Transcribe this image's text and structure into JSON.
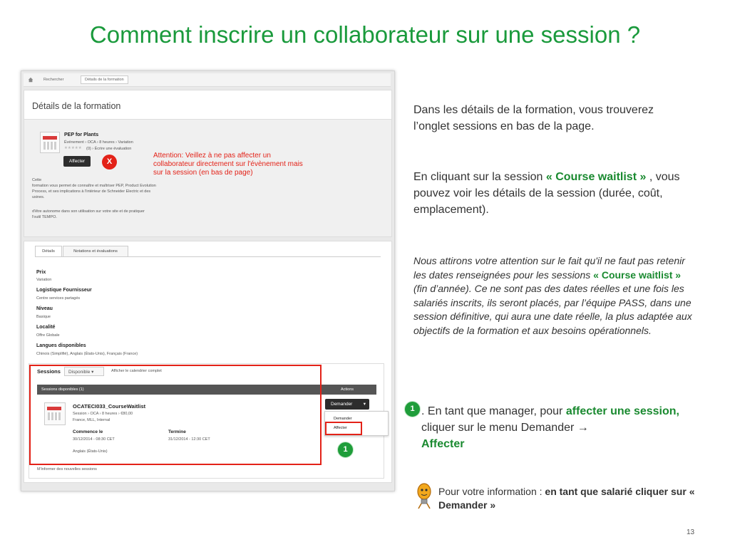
{
  "slide": {
    "title": "Comment inscrire un collaborateur sur une session ?",
    "page_number": "13"
  },
  "screenshot": {
    "breadcrumb": [
      "Rechercher",
      "Détails de la formation"
    ],
    "header_title": "Détails de la formation",
    "course": {
      "name": "PEP for Plants",
      "meta": "Événement  ›  OCA  ›  8 heures  ›  Variation",
      "rating": "(0)  ›  Écrire une évaluation",
      "affect_button": "Affecter",
      "desc1": "Cette",
      "desc2": "formation vous permet de connaître et maîtriser PEP, Product Evolution",
      "desc3": "Process, et ses implications à l'intérieur de Schneider Electric et des",
      "desc4": "usines.",
      "desc5": "d'être autonome dans son utilisation sur votre site et de pratiquer",
      "desc6": "l'outil TEMPO."
    },
    "tabs": [
      "Détails",
      "Notations et évaluations"
    ],
    "details": [
      {
        "label": "Prix",
        "value": "Variation"
      },
      {
        "label": "Logistique Fournisseur",
        "value": "Centre services partagés"
      },
      {
        "label": "Niveau",
        "value": "Basique"
      },
      {
        "label": "Localité",
        "value": "Offre Globale"
      },
      {
        "label": "Langues disponibles",
        "value": "Chinois (Simplifié), Anglais (États-Unis), Français (France)"
      }
    ],
    "sessions": {
      "tab_label": "Sessions",
      "filter": "Disponible",
      "calendar_link": "Afficher le calendrier complet",
      "table_header": "Sessions disponibles (1)",
      "actions_header": "Actions",
      "session_name": "OCATECI033_CourseWaitlist",
      "session_meta": "Session  ›  OCA  ›  8 heures  ›  €80,00",
      "session_loc": "France, MLL, Internal",
      "start_label": "Commence le",
      "start_value": "30/12/2014 - 08:30 CET",
      "end_label": "Termine",
      "end_value": "31/12/2014 - 12:30 CET",
      "language": "Anglais (États-Unis)",
      "demander_button": "Demander",
      "menu_items": [
        "Demander",
        "Affecter"
      ],
      "notify_link": "M'informer des nouvelles sessions"
    },
    "x_badge": "X",
    "step_badge": "1",
    "attention_note": "Attention:  Veillez à ne pas affecter un collaborateur  directement sur l'évènement mais sur la session (en bas de page)"
  },
  "right": {
    "p1": "Dans les détails de la formation, vous trouverez l’onglet sessions en bas de la page.",
    "p2_a": "En cliquant sur la session ",
    "p2_b": "« Course waitlist »",
    "p2_c": " , vous pouvez voir les détails de la session (durée, coût, emplacement).",
    "p3_a": "Nous attirons votre attention sur le fait qu'il ne faut pas retenir les dates renseignées pour les sessions ",
    "p3_b": "« Course waitlist »",
    "p3_c": " (fin d’année). Ce ne sont pas des dates réelles et une fois les salariés inscrits, ils seront placés, par l’équipe PASS, dans une session définitive, qui aura une date réelle, la plus adaptée aux objectifs de la formation et aux besoins opérationnels.",
    "step_badge": "1",
    "p4_a": ". En tant que manager, pour ",
    "p4_b": "affecter une session,",
    "p4_c": " cliquer sur le menu Demander ",
    "p4_arrow": "→",
    "p4_d": "Affecter",
    "info_a": "Pour votre information : ",
    "info_b": "en tant que salarié cliquer sur « Demander »"
  },
  "colors": {
    "title_green": "#1a9a3c",
    "highlight_red": "#e32218",
    "step_green": "#1f9d3a"
  }
}
